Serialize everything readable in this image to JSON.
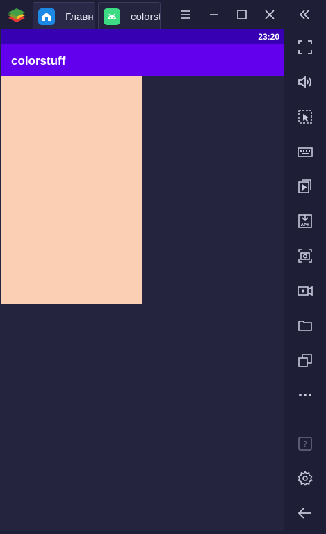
{
  "window": {
    "tabs": [
      {
        "label": "Главн",
        "icon": "home-icon"
      },
      {
        "label": "colorstuff",
        "icon": "android-icon"
      }
    ],
    "controls": [
      "menu-icon",
      "minimize-icon",
      "maximize-icon",
      "close-icon",
      "collapse-sidebar-icon"
    ]
  },
  "android": {
    "status_bar": {
      "time": "23:20"
    },
    "app_bar": {
      "title": "colorstuff"
    },
    "content": {
      "block_color": "#fbcfb4"
    }
  },
  "sidebar": {
    "items": [
      "fullscreen-icon",
      "volume-icon",
      "select-region-icon",
      "keyboard-icon",
      "media-icon",
      "apk-install-icon",
      "screenshot-icon",
      "record-video-icon",
      "folder-icon",
      "multi-instance-icon",
      "more-icon",
      "help-icon",
      "settings-icon",
      "back-icon"
    ]
  },
  "colors": {
    "status_bar": "#3700b3",
    "app_bar": "#6200ee",
    "background": "#24243f",
    "icon": "#c8c8dc"
  }
}
